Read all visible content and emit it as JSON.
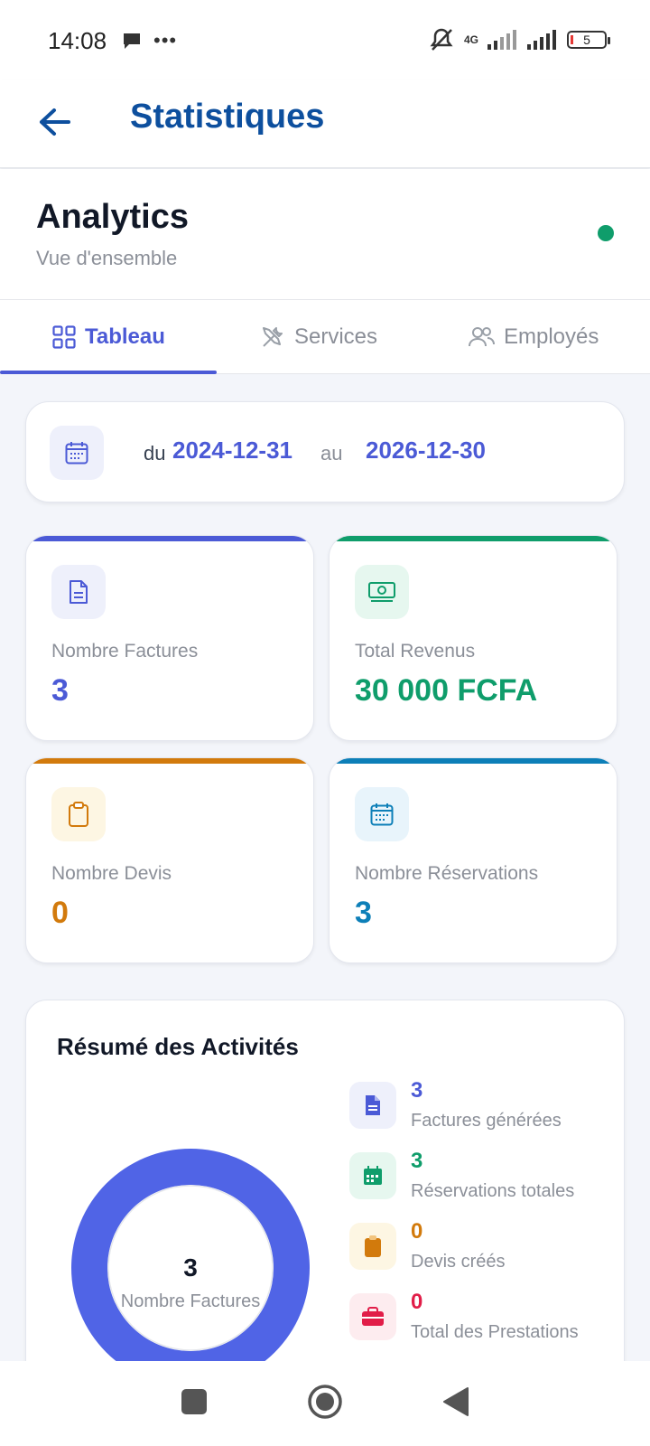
{
  "status_bar": {
    "time": "14:08",
    "network": "4G",
    "battery": "5"
  },
  "app_bar": {
    "title": "Statistiques"
  },
  "header": {
    "title": "Analytics",
    "subtitle": "Vue d'ensemble"
  },
  "tabs": [
    {
      "label": "Tableau",
      "icon": "grid-icon",
      "active": true
    },
    {
      "label": "Services",
      "icon": "tools-icon",
      "active": false
    },
    {
      "label": "Employés",
      "icon": "users-icon",
      "active": false
    }
  ],
  "date_range": {
    "from_prefix": "du",
    "from": "2024-12-31",
    "to_prefix": "au",
    "to": "2026-12-30"
  },
  "stats": [
    {
      "label": "Nombre Factures",
      "value": "3",
      "color": "#4b5ad6",
      "icon": "document-icon"
    },
    {
      "label": "Total Revenus",
      "value": "30 000 FCFA",
      "color": "#0f9d6b",
      "icon": "money-icon"
    },
    {
      "label": "Nombre Devis",
      "value": "0",
      "color": "#d27a0c",
      "icon": "clipboard-icon"
    },
    {
      "label": "Nombre Réservations",
      "value": "3",
      "color": "#0d7fb8",
      "icon": "calendar-icon"
    }
  ],
  "summary": {
    "title": "Résumé des Activités",
    "donut_center_value": "3",
    "donut_center_label": "Nombre Factures",
    "items": [
      {
        "value": "3",
        "label": "Factures générées",
        "color": "#4b5ad6",
        "icon": "document-icon"
      },
      {
        "value": "3",
        "label": "Réservations totales",
        "color": "#0f9d6b",
        "icon": "calendar-icon"
      },
      {
        "value": "0",
        "label": "Devis créés",
        "color": "#d27a0c",
        "icon": "clipboard-icon"
      },
      {
        "value": "0",
        "label": "Total des Prestations",
        "color": "#e11d48",
        "icon": "briefcase-icon"
      }
    ]
  },
  "chart_data": {
    "type": "pie",
    "categories": [
      "Nombre Factures"
    ],
    "values": [
      3
    ],
    "title": "",
    "colors": [
      "#5064e6"
    ]
  }
}
